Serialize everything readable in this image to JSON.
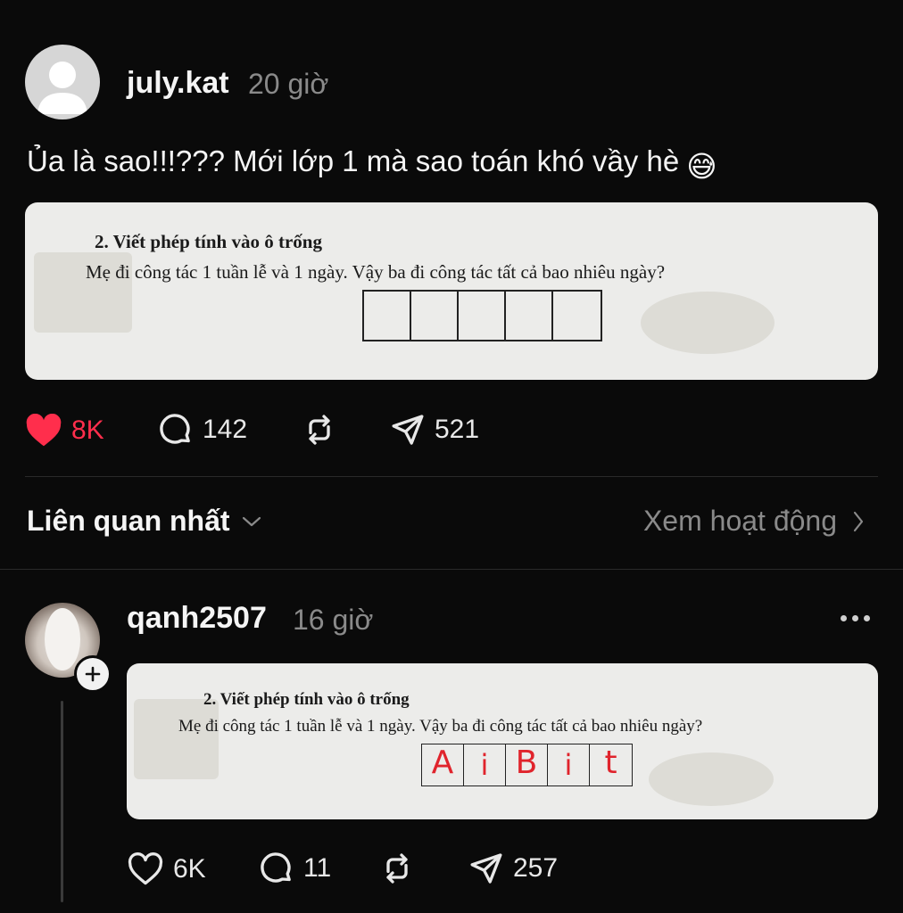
{
  "post": {
    "username": "july.kat",
    "time": "20 giờ",
    "text": "Ủa là sao!!!??? Mới lớp 1 mà sao toán khó vầy hè",
    "emoji": "😅",
    "image": {
      "question_title": "2. Viết phép tính vào ô trống",
      "question_body": "Mẹ đi công tác 1 tuần lễ và 1 ngày. Vậy ba đi công tác tất cả bao nhiêu ngày?",
      "box_count": 5
    },
    "actions": {
      "likes": "8K",
      "comments": "142",
      "shares": "521"
    }
  },
  "sort": {
    "label": "Liên quan nhất",
    "activity_link": "Xem hoạt động"
  },
  "reply": {
    "username": "qanh2507",
    "time": "16 giờ",
    "image": {
      "question_title": "2. Viết phép tính vào ô trống",
      "question_body": "Mẹ đi công tác 1 tuần lễ và 1 ngày. Vậy ba đi công tác tất cả bao nhiêu ngày?",
      "answers": [
        "A",
        "i",
        "B",
        "i",
        "t"
      ]
    },
    "actions": {
      "likes": "6K",
      "comments": "11",
      "shares": "257"
    }
  },
  "colors": {
    "background": "#0a0a0a",
    "like_active": "#ff2e4c",
    "secondary_text": "#8a8a8a",
    "answer_ink": "#e0242c"
  }
}
